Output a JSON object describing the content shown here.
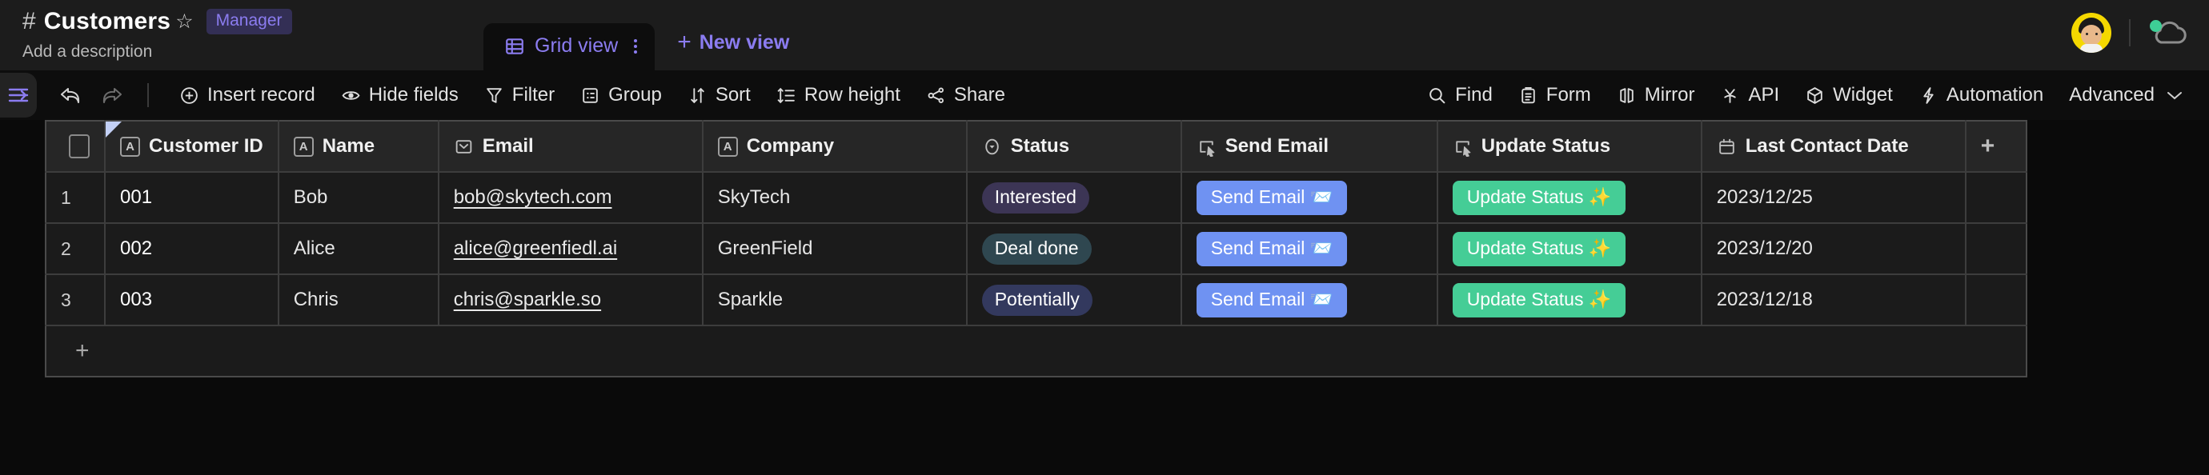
{
  "header": {
    "hash_icon": "hash-icon",
    "title": "Customers",
    "star_icon": "star-icon",
    "role_badge": "Manager",
    "description_placeholder": "Add a description",
    "avatar_name": "user-avatar",
    "cloud_icon": "cloud-sync-icon",
    "status_dot_color": "#3ecf96"
  },
  "views": {
    "active_tab": "Grid view",
    "tab_icon": "grid-icon",
    "tab_menu_icon": "more-vertical-icon",
    "new_view_label": "New view",
    "new_view_icon": "plus-icon",
    "accent_color": "#8b7cf0"
  },
  "toolbar": {
    "sidebar_toggle_icon": "sidebar-collapse-icon",
    "undo_icon": "undo-arrow-icon",
    "redo_icon": "redo-arrow-icon",
    "left_items": [
      {
        "label": "Insert record",
        "icon": "plus-circle-icon"
      },
      {
        "label": "Hide fields",
        "icon": "eye-icon"
      },
      {
        "label": "Filter",
        "icon": "funnel-icon"
      },
      {
        "label": "Group",
        "icon": "group-icon"
      },
      {
        "label": "Sort",
        "icon": "sort-arrows-icon"
      },
      {
        "label": "Row height",
        "icon": "row-height-icon"
      },
      {
        "label": "Share",
        "icon": "share-nodes-icon"
      }
    ],
    "right_items": [
      {
        "label": "Find",
        "icon": "search-icon"
      },
      {
        "label": "Form",
        "icon": "clipboard-icon"
      },
      {
        "label": "Mirror",
        "icon": "mirror-icon"
      },
      {
        "label": "API",
        "icon": "plug-icon"
      },
      {
        "label": "Widget",
        "icon": "cube-icon"
      },
      {
        "label": "Automation",
        "icon": "lightning-icon"
      }
    ],
    "advanced_label": "Advanced",
    "advanced_chevron": "chevron-down-icon"
  },
  "table": {
    "select_all_icon": "checkbox-icon",
    "add_field_icon": "plus-icon",
    "add_row_icon": "plus-icon",
    "columns": [
      {
        "label": "Customer ID",
        "type_icon": "text-field-icon"
      },
      {
        "label": "Name",
        "type_icon": "text-field-icon"
      },
      {
        "label": "Email",
        "type_icon": "email-field-icon"
      },
      {
        "label": "Company",
        "type_icon": "text-field-icon"
      },
      {
        "label": "Status",
        "type_icon": "single-select-icon"
      },
      {
        "label": "Send Email",
        "type_icon": "button-field-icon"
      },
      {
        "label": "Update Status",
        "type_icon": "button-field-icon"
      },
      {
        "label": "Last Contact Date",
        "type_icon": "calendar-icon"
      }
    ],
    "rows": [
      {
        "num": "1",
        "customer_id": "001",
        "name": "Bob",
        "email": "bob@skytech.com",
        "company": "SkyTech",
        "status": "Interested",
        "status_color": "#3c3555",
        "send_email": "Send Email 📨",
        "update_status": "Update Status ✨",
        "last_contact": "2023/12/25"
      },
      {
        "num": "2",
        "customer_id": "002",
        "name": "Alice",
        "email": "alice@greenfiedl.ai",
        "company": "GreenField",
        "status": "Deal done",
        "status_color": "#2f4750",
        "send_email": "Send Email 📨",
        "update_status": "Update Status ✨",
        "last_contact": "2023/12/20"
      },
      {
        "num": "3",
        "customer_id": "003",
        "name": "Chris",
        "email": "chris@sparkle.so",
        "company": "Sparkle",
        "status": "Potentially",
        "status_color": "#33395e",
        "send_email": "Send Email 📨",
        "update_status": "Update Status ✨",
        "last_contact": "2023/12/18"
      }
    ],
    "send_button_color": "#6f92f2",
    "update_button_color": "#45cd96"
  }
}
